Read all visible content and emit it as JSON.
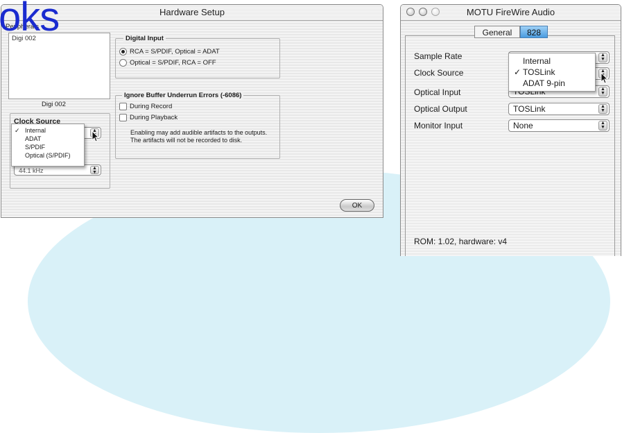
{
  "overlay": {
    "text": "oks"
  },
  "hardware_window": {
    "title": "Hardware Setup",
    "peripherals_label": "Peripherals",
    "peripherals_item": "Digi 002",
    "device_label": "Digi 002",
    "digital_input": {
      "title": "Digital Input",
      "options": [
        "RCA = S/PDIF, Optical = ADAT",
        "Optical = S/PDIF, RCA = OFF"
      ]
    },
    "buffer": {
      "title": "Ignore Buffer Underrun Errors (-6086)",
      "options": [
        "During Record",
        "During Playback"
      ],
      "note_line1": "Enabling may add audible artifacts to the outputs.",
      "note_line2": "The artifacts will not be recorded to disk."
    },
    "clock_source": {
      "title": "Clock Source",
      "options": [
        "Internal",
        "ADAT",
        "S/PDIF",
        "Optical (S/PDIF)"
      ],
      "check": "✓",
      "sample_rate_value": "44.1 kHz"
    },
    "ok_label": "OK"
  },
  "motu_window": {
    "title": "MOTU FireWire Audio",
    "tabs": [
      "General",
      "828"
    ],
    "labels": {
      "sample_rate": "Sample Rate",
      "clock_source": "Clock Source",
      "optical_input": "Optical Input",
      "optical_output": "Optical Output",
      "monitor_input": "Monitor Input"
    },
    "values": {
      "optical_input": "TOSLink",
      "optical_output": "TOSLink",
      "monitor_input": "None"
    },
    "clock_menu": [
      "Internal",
      "TOSLink",
      "ADAT 9-pin"
    ],
    "check": "✓",
    "footer": "ROM: 1.02, hardware: v4"
  },
  "colors": {
    "accent_circle": "#d9f1f8",
    "overlay_text": "#1a2bcf"
  },
  "icons": [
    "cursor-arrow-icon",
    "window-close-icon",
    "window-minimize-icon",
    "window-zoom-icon",
    "popup-arrows-icon"
  ]
}
